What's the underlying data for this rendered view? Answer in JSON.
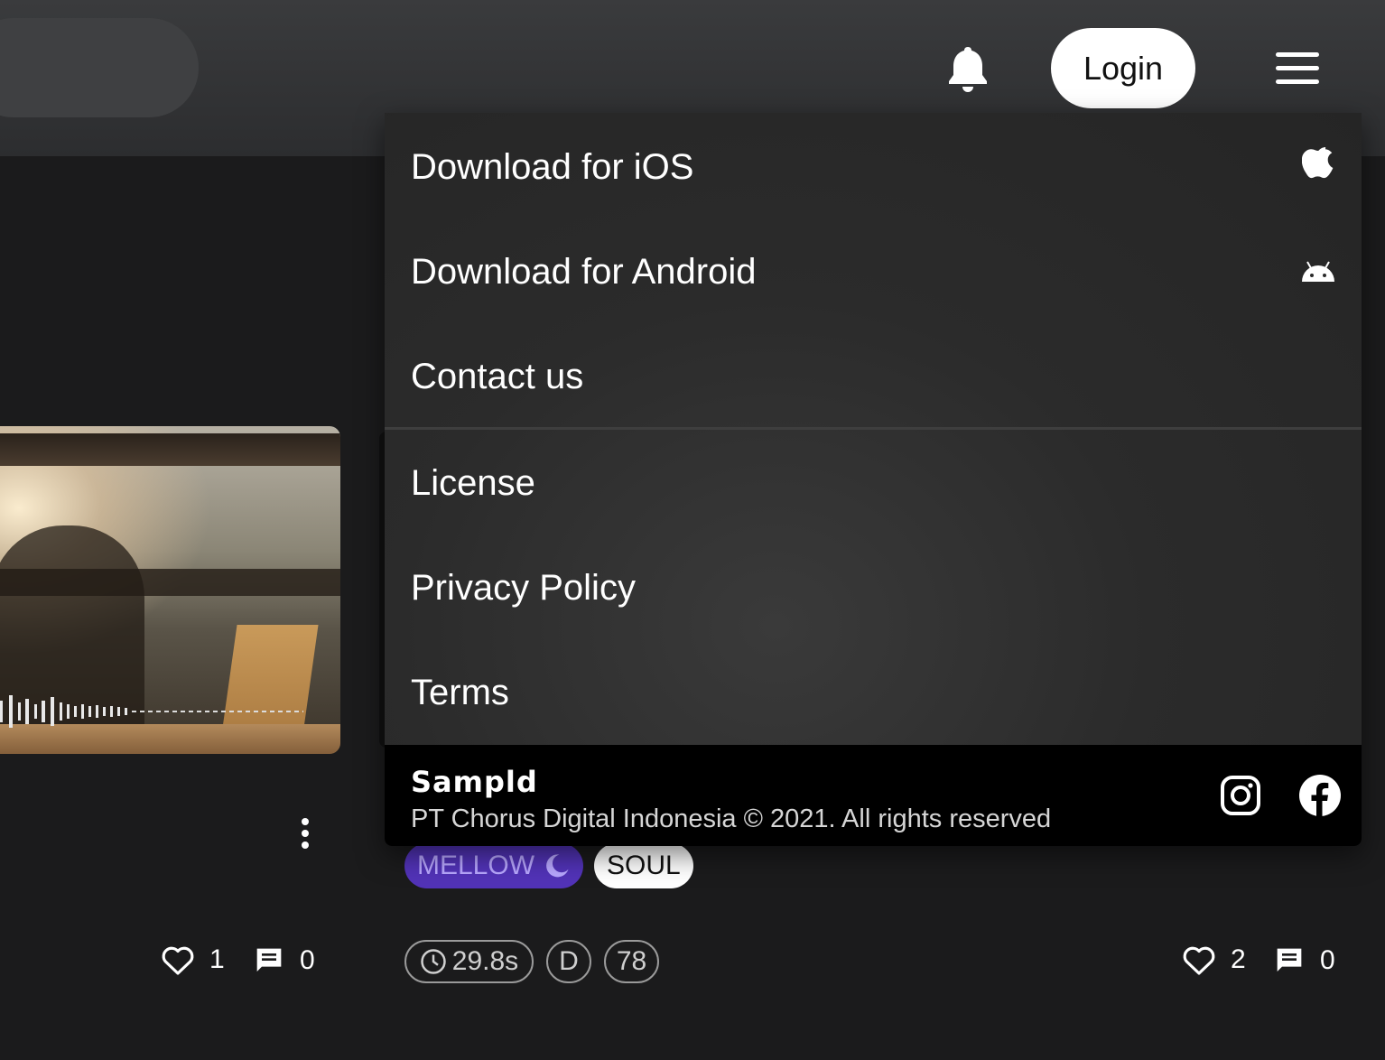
{
  "header": {
    "login_label": "Login"
  },
  "menu": {
    "items": [
      {
        "label": "Download for iOS",
        "icon": "apple-icon"
      },
      {
        "label": "Download for Android",
        "icon": "android-icon"
      },
      {
        "label": "Contact us"
      },
      {
        "label": "License"
      },
      {
        "label": "Privacy Policy"
      },
      {
        "label": "Terms"
      }
    ],
    "footer": {
      "brand": "Sampld",
      "copyright": "PT Chorus Digital Indonesia © 2021. All rights reserved",
      "social": [
        "instagram-icon",
        "facebook-icon"
      ]
    }
  },
  "left_card": {
    "likes": "1",
    "comments": "0"
  },
  "right_card": {
    "tags": [
      "MELLOW",
      "SOUL"
    ],
    "duration": "29.8s",
    "key": "D",
    "bpm": "78",
    "likes": "2",
    "comments": "0"
  },
  "colors": {
    "mellow_tag_bg": "#5233b8",
    "mellow_tag_text": "#b9a8ff"
  }
}
